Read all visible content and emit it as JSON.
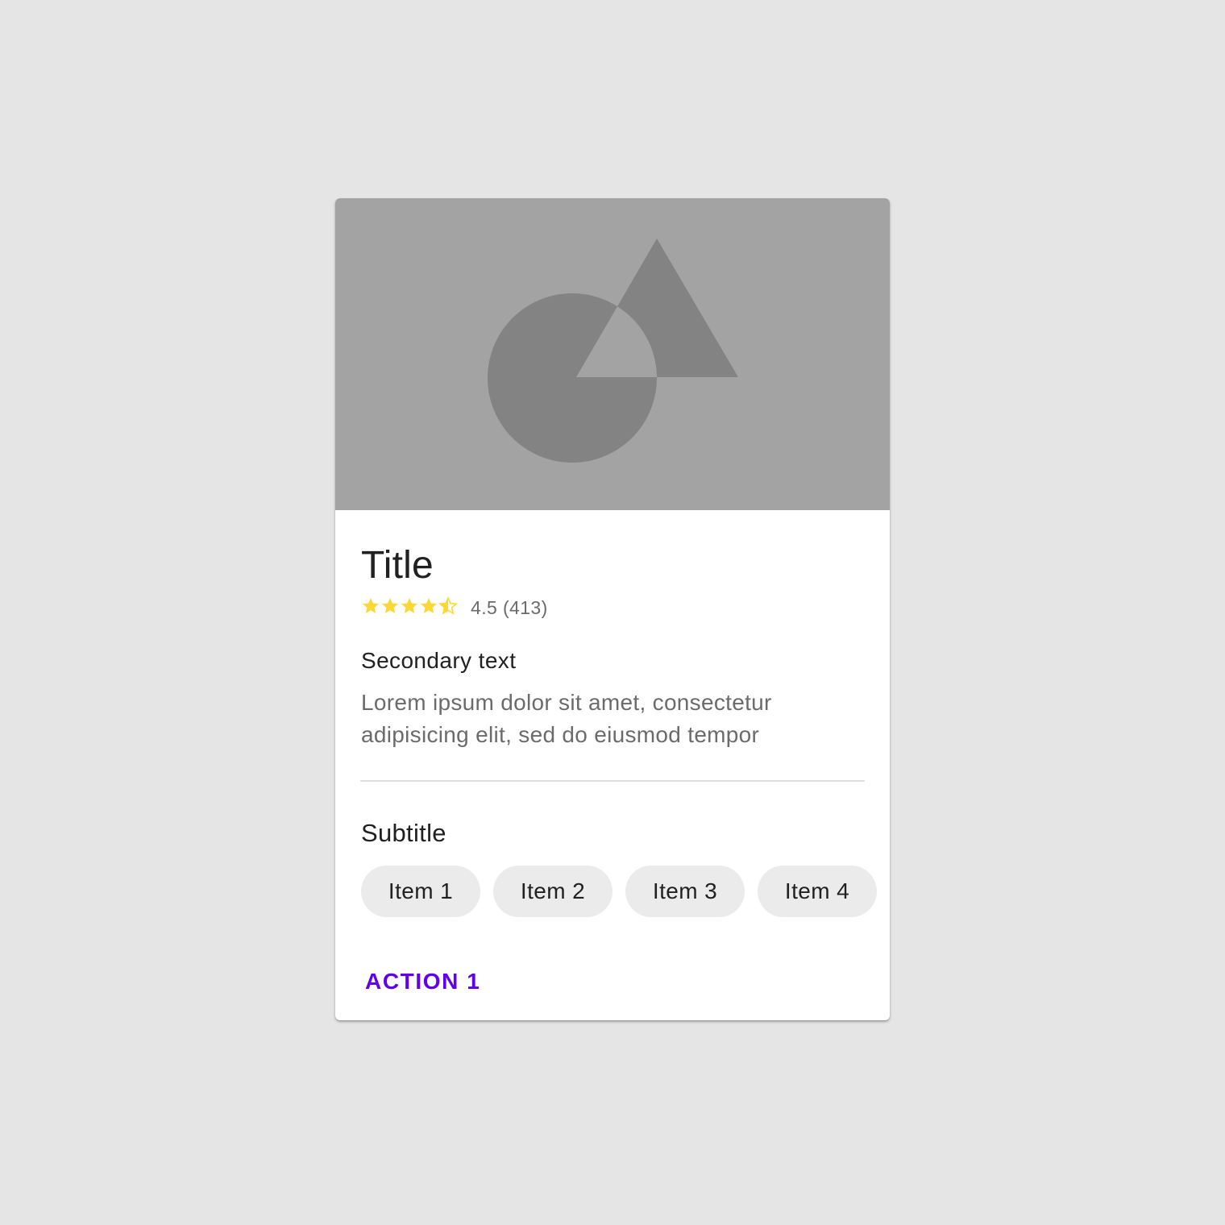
{
  "card": {
    "title": "Title",
    "rating": {
      "value": 4.5,
      "max": 5,
      "text": "4.5 (413)",
      "star_color": "#fdd835"
    },
    "secondary_text": "Secondary text",
    "body_text": "Lorem ipsum dolor sit amet, consectetur adipisicing elit, sed do eiusmod tempor",
    "subtitle": "Subtitle",
    "chips": [
      {
        "label": "Item 1"
      },
      {
        "label": "Item 2"
      },
      {
        "label": "Item 3"
      },
      {
        "label": "Item 4"
      }
    ],
    "action_label": "ACTION 1",
    "media_icon": "image-placeholder-icon"
  },
  "colors": {
    "page_background": "#e5e5e5",
    "media_background": "#a3a3a3",
    "media_shapes": "#838383",
    "accent": "#6200ee",
    "chip_background": "#ebebeb"
  }
}
